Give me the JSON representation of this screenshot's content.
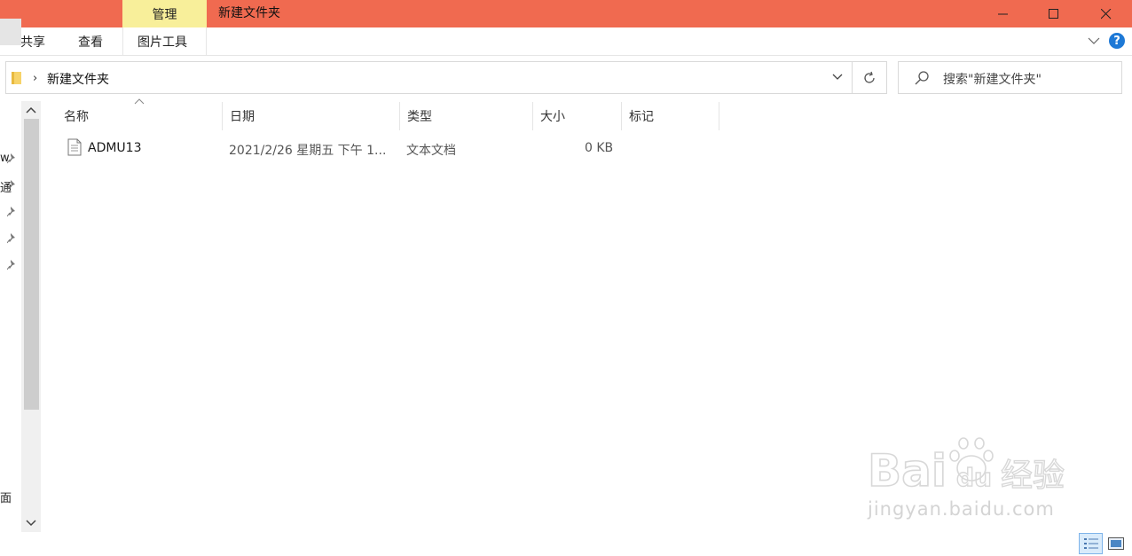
{
  "window": {
    "title": "新建文件夹",
    "context_tab": "管理",
    "accent_color": "#f06a50",
    "context_tab_color": "#f8ef9a",
    "controls": [
      "minimize-icon",
      "maximize-icon",
      "close-icon"
    ]
  },
  "ribbon": {
    "tabs": [
      "共享",
      "查看",
      "图片工具"
    ]
  },
  "address": {
    "path": "新建文件夹",
    "search_placeholder": "搜索\"新建文件夹\""
  },
  "nav": {
    "partial_items": [
      "w",
      "通",
      "面"
    ]
  },
  "columns": [
    "名称",
    "日期",
    "类型",
    "大小",
    "标记"
  ],
  "files": [
    {
      "name": "ADMU13",
      "date": "2021/2/26 星期五 下午 1...",
      "type": "文本文档",
      "size": "0 KB",
      "tag": ""
    }
  ],
  "watermark": {
    "brand": "Bai",
    "brand2": "du",
    "cn": "经验",
    "url": "jingyan.baidu.com"
  }
}
